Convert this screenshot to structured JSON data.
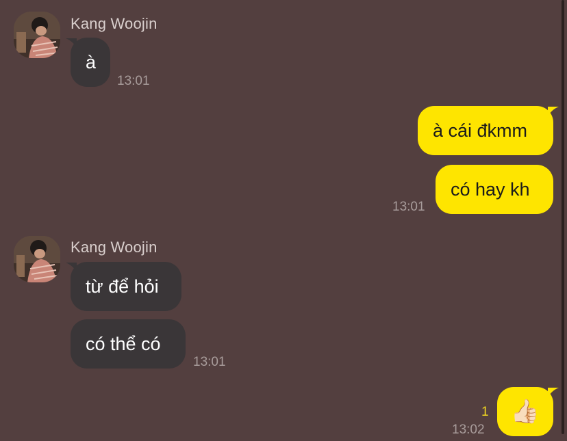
{
  "messages": [
    {
      "sender": "Kang Woojin",
      "bubbles": [
        "à"
      ],
      "time": "13:01"
    },
    {
      "outgoing": true,
      "bubbles": [
        "à cái đkmm",
        "có hay kh"
      ],
      "time": "13:01"
    },
    {
      "sender": "Kang Woojin",
      "bubbles": [
        "từ để hỏi",
        "có thể có"
      ],
      "time": "13:01"
    },
    {
      "outgoing": true,
      "bubbles": [
        "👍🏻"
      ],
      "time": "13:02",
      "unread": "1"
    }
  ],
  "colors": {
    "background": "#533f3f",
    "incoming_bubble": "#3a3638",
    "outgoing_bubble": "#fee500",
    "unread_count": "#f3d820"
  },
  "icons": {
    "avatar": "profile-photo",
    "reaction": "thumbs-up-icon"
  }
}
